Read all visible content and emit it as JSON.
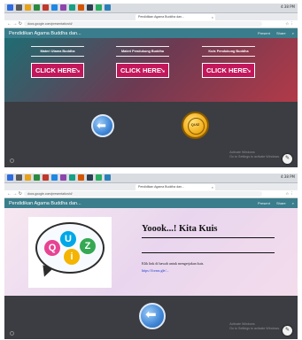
{
  "browser_top": {
    "tabs": [
      {
        "label": "Pendidikan Agama Buddha dan...",
        "active": true
      }
    ],
    "url": "docs.google.com/presentation/d/",
    "clock": "4:38 PM"
  },
  "browser_bottom": {
    "tabs": [
      {
        "label": "Pendidikan Agama Buddha dan...",
        "active": true
      }
    ],
    "url": "docs.google.com/presentation/d/",
    "clock": "4:38 PM"
  },
  "site": {
    "title": "Pendidikan Agama Buddha dan...",
    "nav": [
      "Present",
      "Share"
    ]
  },
  "slide1": {
    "menus": [
      {
        "label": "Materi Utama Buddha",
        "button": "CLICK HERE"
      },
      {
        "label": "Materi Pendukung Buddha",
        "button": "CLICK HERE"
      },
      {
        "label": "Kuis Pendukung Buddha",
        "button": "CLICK HERE"
      }
    ],
    "coin_text": "QUIZ"
  },
  "slide2": {
    "title": "Yoook...! Kita Kuis",
    "instruction": "Klik link di bawah untuk mengerjakan kuis.",
    "link": "https://forms.gle/..."
  },
  "watermark": {
    "line1": "Activate Windows",
    "line2": "Go to Settings to activate Windows."
  },
  "colors": {
    "header": "#3a7d8c",
    "click_button": "#c2185b",
    "back_button": "#3f86d6",
    "coin": "#f2b01c"
  },
  "icons": {
    "back": "arrow-left-icon",
    "cursor": "pointer-cursor-icon",
    "edit": "pencil-icon",
    "settings": "settings-icon"
  }
}
